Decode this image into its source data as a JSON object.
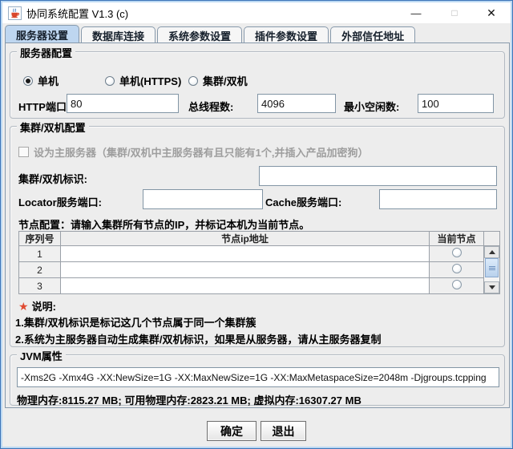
{
  "window": {
    "title": "协同系统配置 V1.3 (c)",
    "minimize_glyph": "—",
    "maximize_glyph": "□",
    "close_glyph": "✕"
  },
  "tabs": [
    {
      "label": "服务器设置",
      "selected": true
    },
    {
      "label": "数据库连接",
      "selected": false
    },
    {
      "label": "系统参数设置",
      "selected": false
    },
    {
      "label": "插件参数设置",
      "selected": false
    },
    {
      "label": "外部信任地址",
      "selected": false
    }
  ],
  "server_config": {
    "group_title": "服务器配置",
    "radios": [
      {
        "label": "单机",
        "selected": true
      },
      {
        "label": "单机(HTTPS)",
        "selected": false
      },
      {
        "label": "集群/双机",
        "selected": false
      }
    ],
    "fields": [
      {
        "label": "HTTP端口:",
        "value": "80"
      },
      {
        "label": "总线程数:",
        "value": "4096"
      },
      {
        "label": "最小空闲数:",
        "value": "100"
      }
    ]
  },
  "cluster_config": {
    "group_title": "集群/双机配置",
    "master_checkbox_label": "设为主服务器（集群/双机中主服务器有且只能有1个,并插入产品加密狗）",
    "master_checkbox_checked": false,
    "cluster_id_label": "集群/双机标识:",
    "cluster_id_value": "",
    "locator_label": "Locator服务端口:",
    "locator_value": "",
    "cache_label": "Cache服务端口:",
    "cache_value": "",
    "node_config_hint": "节点配置：请输入集群所有节点的IP，并标记本机为当前节点。",
    "table": {
      "headers": [
        "序列号",
        "节点ip地址",
        "当前节点"
      ],
      "rows": [
        {
          "seq": "1",
          "ip": "",
          "is_current": false
        },
        {
          "seq": "2",
          "ip": "",
          "is_current": false
        },
        {
          "seq": "3",
          "ip": "",
          "is_current": false
        }
      ]
    },
    "notes": {
      "title": "说明:",
      "lines": [
        "1.集群/双机标识是标记这几个节点属于同一个集群簇",
        "2.系统为主服务器自动生成集群/双机标识，如果是从服务器，请从主服务器复制"
      ]
    }
  },
  "jvm": {
    "group_title": "JVM属性",
    "args_value": "-Xms2G -Xmx4G -XX:NewSize=1G -XX:MaxNewSize=1G -XX:MaxMetaspaceSize=2048m -Djgroups.tcpping",
    "memory_info": "物理内存:8115.27 MB; 可用物理内存:2823.21 MB; 虚拟内存:16307.27 MB"
  },
  "footer": {
    "ok_label": "确定",
    "exit_label": "退出"
  },
  "colors": {
    "window_border": "#3c74b8",
    "selected_tab_bg": "#bed6f0",
    "panel_bg": "#ededed",
    "star_red": "#e04a31"
  }
}
